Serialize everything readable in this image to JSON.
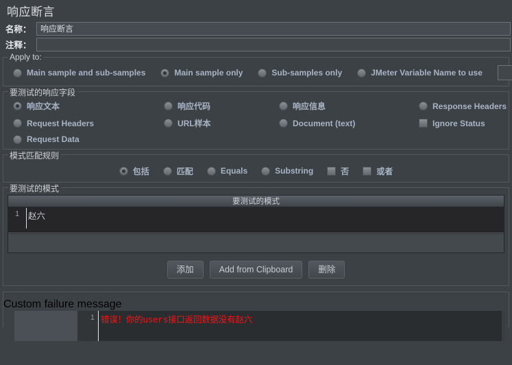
{
  "window": {
    "title": "响应断言"
  },
  "fields": {
    "name_label": "名称：",
    "name_value": "响应断言",
    "comment_label": "注释：",
    "comment_value": ""
  },
  "apply_to": {
    "legend": "Apply to:",
    "options": [
      {
        "label": "Main sample and sub-samples",
        "selected": false
      },
      {
        "label": "Main sample only",
        "selected": true
      },
      {
        "label": "Sub-samples only",
        "selected": false
      },
      {
        "label": "JMeter Variable Name to use",
        "selected": false
      }
    ],
    "variable_value": "",
    "variable_placeholder": ""
  },
  "response_fields": {
    "legend": "要测试的响应字段",
    "options": [
      {
        "label": "响应文本",
        "type": "radio",
        "selected": true
      },
      {
        "label": "响应代码",
        "type": "radio",
        "selected": false
      },
      {
        "label": "响应信息",
        "type": "radio",
        "selected": false
      },
      {
        "label": "Response Headers",
        "type": "radio",
        "selected": false
      },
      {
        "label": "Request Headers",
        "type": "radio",
        "selected": false
      },
      {
        "label": "URL样本",
        "type": "radio",
        "selected": false
      },
      {
        "label": "Document (text)",
        "type": "radio",
        "selected": false
      },
      {
        "label": "Ignore Status",
        "type": "checkbox",
        "selected": false
      },
      {
        "label": "Request Data",
        "type": "radio",
        "selected": false
      }
    ]
  },
  "match_rules": {
    "legend": "模式匹配规则",
    "options": [
      {
        "label": "包括",
        "type": "radio",
        "selected": true
      },
      {
        "label": "匹配",
        "type": "radio",
        "selected": false
      },
      {
        "label": "Equals",
        "type": "radio",
        "selected": false
      },
      {
        "label": "Substring",
        "type": "radio",
        "selected": false
      },
      {
        "label": "否",
        "type": "checkbox",
        "selected": false
      },
      {
        "label": "或者",
        "type": "checkbox",
        "selected": false
      }
    ]
  },
  "patterns": {
    "legend": "要测试的模式",
    "column_header": "要测试的模式",
    "rows": [
      {
        "num": "1",
        "value": "赵六"
      }
    ],
    "buttons": [
      {
        "label": "添加",
        "name": "add-button"
      },
      {
        "label": "Add from Clipboard",
        "name": "add-from-clipboard-button"
      },
      {
        "label": "删除",
        "name": "delete-button"
      }
    ]
  },
  "custom_failure_message": {
    "legend": "Custom failure message",
    "line_number": "1",
    "text": "错误！你的users接口返回数据没有赵六",
    "text_color": "#fb1111"
  }
}
